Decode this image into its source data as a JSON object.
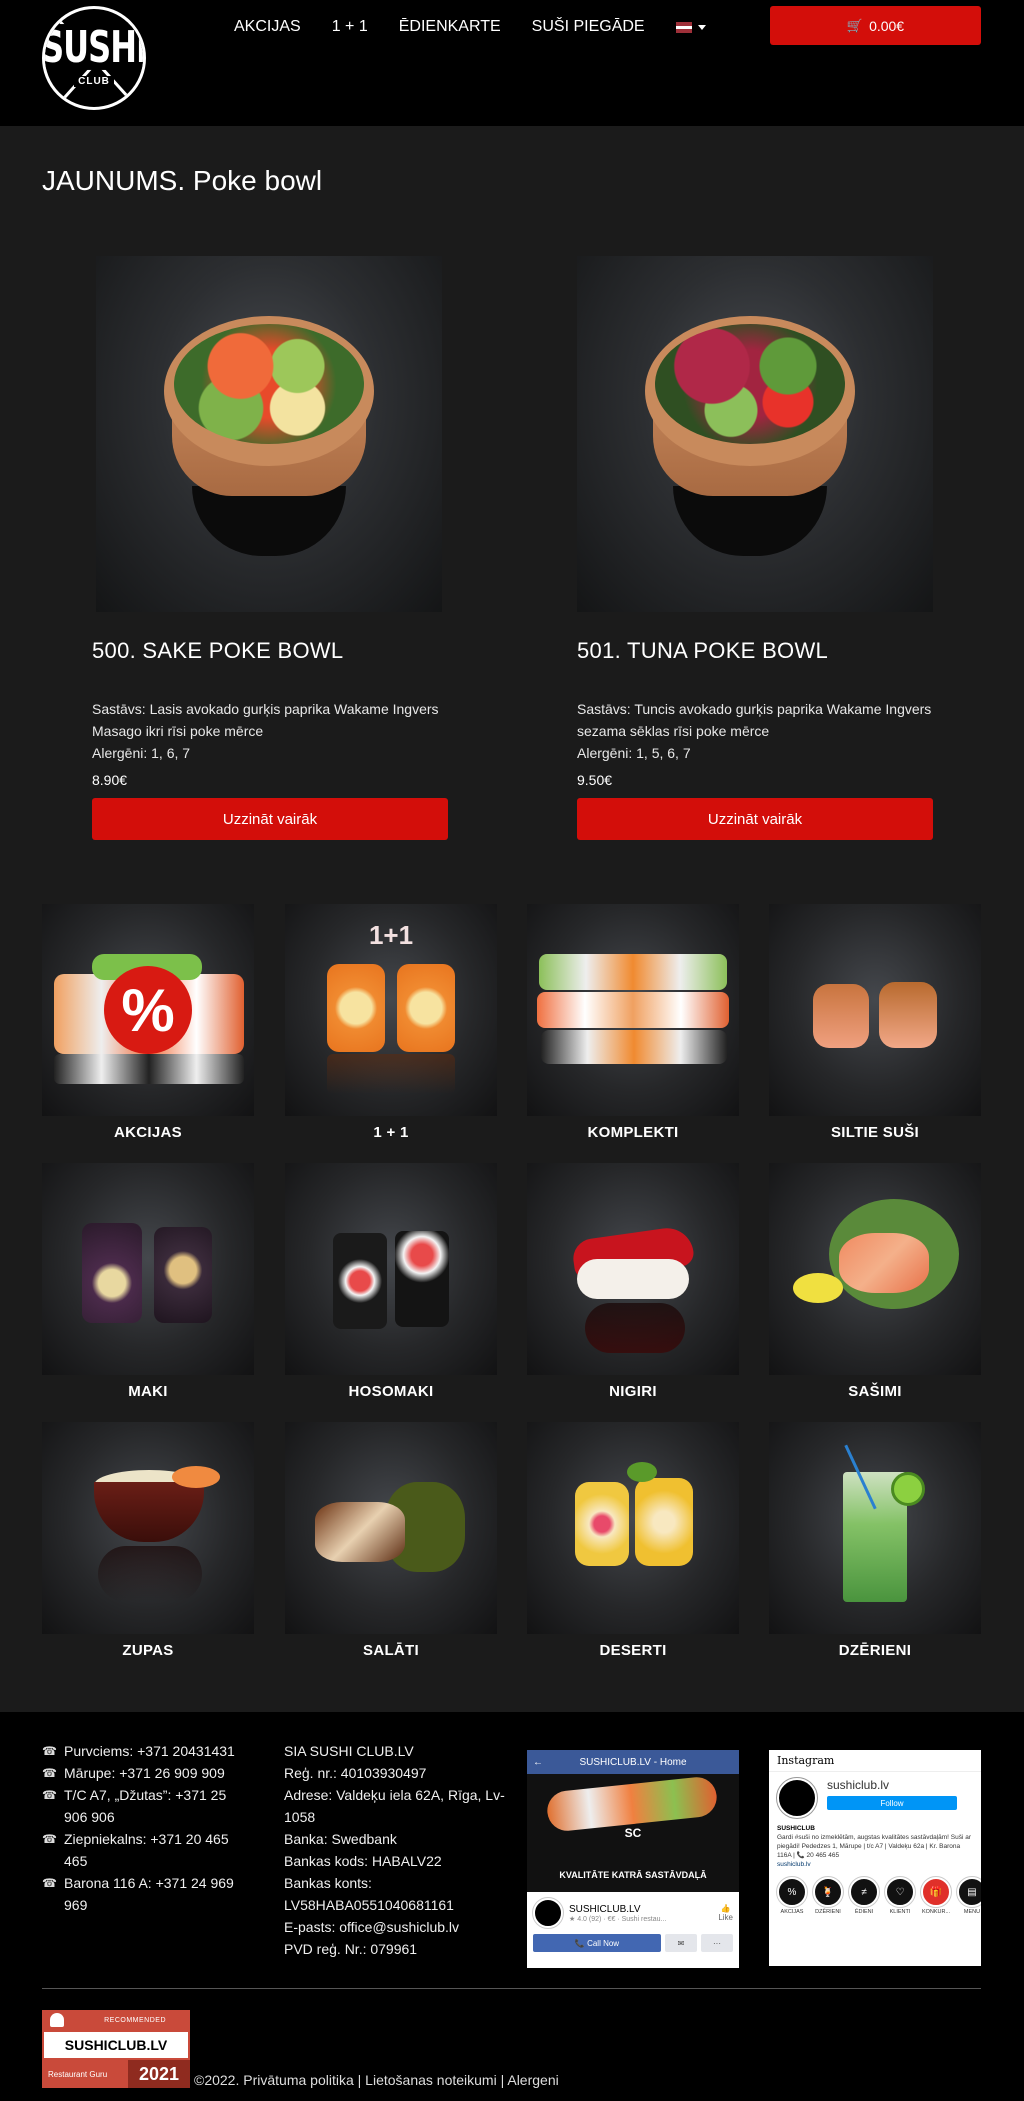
{
  "header": {
    "logo_text": "SUSHI",
    "logo_sub": "CLUB",
    "nav": [
      "AKCIJAS",
      "1 + 1",
      "ĒDIENKARTE",
      "SUŠI PIEGĀDE"
    ],
    "language": "Latvian",
    "cart_total": "0.00€",
    "cart_icon": "shopping-cart-icon"
  },
  "main": {
    "section_title": "JAUNUMS. Poke bowl",
    "products": [
      {
        "title": "500. SAKE POKE BOWL",
        "ingredients": "Sastāvs: Lasis avokado gurķis paprika Wakame Ingvers Masago ikri rīsi poke mērce",
        "allergens": "Alergēni: 1, 6, 7",
        "price": "8.90€",
        "button": "Uzzināt vairāk"
      },
      {
        "title": "501. TUNA POKE BOWL",
        "ingredients": "Sastāvs: Tuncis avokado gurķis paprika Wakame Ingvers sezama sēklas rīsi poke mērce",
        "allergens": "Alergēni: 1, 5, 6, 7",
        "price": "9.50€",
        "button": "Uzzināt vairāk"
      }
    ],
    "categories": [
      "AKCIJAS",
      "1 + 1",
      "KOMPLEKTI",
      "SILTIE SUŠI",
      "MAKI",
      "HOSOMAKI",
      "NIGIRI",
      "SAŠIMI",
      "ZUPAS",
      "SALĀTI",
      "DESERTI",
      "DZĒRIENI"
    ],
    "promo_overlay": {
      "percent": "%",
      "one_plus_one": "1+1"
    }
  },
  "footer": {
    "phones": [
      "Purvciems: +371 20431431",
      "Mārupe: +371 26 909 909",
      "T/C A7, „Džutas”: +371 25 906 906",
      "Ziepniekalns: +371 20 465 465",
      "Barona 116 A: +371 24 969 969"
    ],
    "company": [
      "SIA SUSHI CLUB.LV",
      "Reģ. nr.: 40103930497",
      "Adrese: Valdeķu iela 62A, Rīga, Lv-1058",
      "Banka: Swedbank",
      "Bankas kods: HABALV22",
      "Bankas konts: LV58HABA0551040681161",
      "E-pasts: office@sushiclub.lv",
      "PVD reģ. Nr.: 079961"
    ],
    "facebook": {
      "header": "SUSHICLUB.LV - Home",
      "banner_logo": "SC",
      "banner_text": "KVALITĀTE KATRĀ SASTĀVDAĻĀ",
      "page_name": "SUSHICLUB.LV",
      "rating": "★ 4.0 (92) · €€ · Sushi restau...",
      "like": "Like",
      "call": "Call Now"
    },
    "instagram": {
      "logo": "Instagram",
      "handle": "sushiclub.lv",
      "follow": "Follow",
      "bio_name": "SUSHICLUB",
      "bio": "Gardi #suši no izmeklētām, augstas kvalitātes sastāvdaļām! Suši ar piegādi! Pededzes 1, Mārupe | t/c A7 | Valdeķu 62a | Kr. Barona 116A | 📞 20 465 465",
      "bio_link": "sushiclub.lv",
      "highlights": [
        "AKCIJAS",
        "DZĒRIENI",
        "ĒDIENI",
        "KLIENTI",
        "KONKUR...",
        "MENU"
      ]
    },
    "badge": {
      "recommended": "RECOMMENDED",
      "name": "SUSHICLUB.LV",
      "source": "Restaurant Guru",
      "year": "2021"
    },
    "copyright": "©2022.",
    "links": [
      "Privātuma politika",
      "Lietošanas noteikumi",
      "Alergeni"
    ]
  }
}
